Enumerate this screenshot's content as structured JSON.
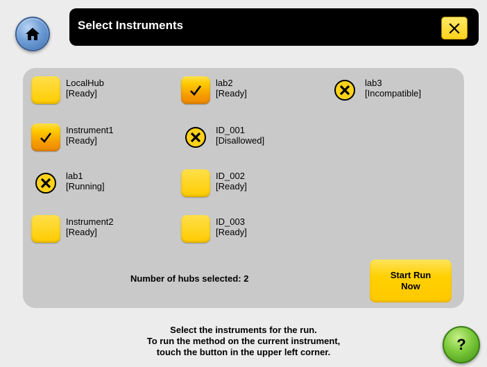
{
  "header": {
    "title": "Select Instruments"
  },
  "instruments": [
    {
      "name": "LocalHub",
      "status": "[Ready]",
      "state": "unchecked"
    },
    {
      "name": "lab2",
      "status": "[Ready]",
      "state": "checked"
    },
    {
      "name": "lab3",
      "status": "[Incompatible]",
      "state": "unavailable"
    },
    {
      "name": "Instrument1",
      "status": "[Ready]",
      "state": "checked"
    },
    {
      "name": "ID_001",
      "status": "[Disallowed]",
      "state": "unavailable"
    },
    {
      "name": "lab1",
      "status": "[Running]",
      "state": "unavailable"
    },
    {
      "name": "ID_002",
      "status": "[Ready]",
      "state": "unchecked"
    },
    {
      "name": "Instrument2",
      "status": "[Ready]",
      "state": "unchecked"
    },
    {
      "name": "ID_003",
      "status": "[Ready]",
      "state": "unchecked"
    }
  ],
  "footer": {
    "selected_count_text": "Number of hubs selected: 2",
    "start_button_line1": "Start Run",
    "start_button_line2": "Now"
  },
  "instructions": {
    "line1": "Select the instruments for the run.",
    "line2": "To run the method on the current instrument,",
    "line3": "touch the button in the upper left corner."
  },
  "help": {
    "label": "?"
  },
  "icons": {
    "home": "home-icon",
    "close": "close-icon",
    "check": "checkmark-icon",
    "unavailable": "x-circle-icon",
    "help": "help-icon"
  },
  "colors": {
    "accent_yellow": "#ffcb00",
    "checked_orange": "#f08a00",
    "panel": "#c9c9c9",
    "title_bar": "#000000",
    "home_blue": "#6f9ed6",
    "help_green": "#7cc93a"
  }
}
